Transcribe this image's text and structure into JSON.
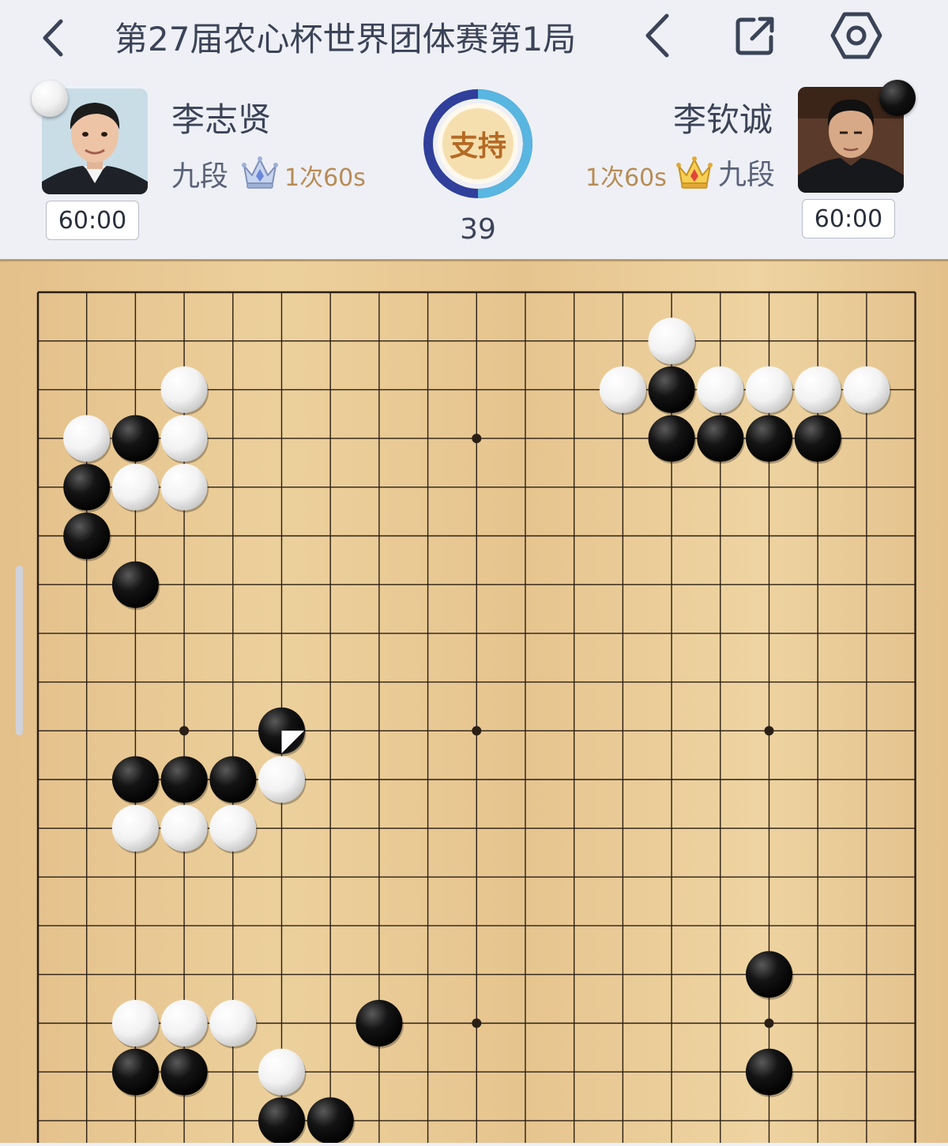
{
  "topbar": {
    "title": "第27届农心杯世界团体赛第1局",
    "back_icon": "chevron-left-icon",
    "prev_icon": "chevron-left-icon",
    "share_icon": "share-external-icon",
    "settings_icon": "gear-hexagon-icon"
  },
  "players": {
    "white": {
      "name": "李志贤",
      "rank": "九段",
      "byoyomi": "1次60s",
      "clock": "60:00",
      "stone": "white",
      "crown": "silver-crown-icon"
    },
    "black": {
      "name": "李钦诚",
      "rank": "九段",
      "byoyomi": "1次60s",
      "clock": "60:00",
      "stone": "black",
      "crown": "gold-crown-icon"
    }
  },
  "support": {
    "label": "支持",
    "white_share": 0.5,
    "black_share": 0.5
  },
  "move_number": "39",
  "colors": {
    "board": "#e8c890",
    "white_side": "#58b6e0",
    "black_side": "#2f3f9a",
    "accent_text": "#b88c55"
  },
  "board": {
    "size": 19,
    "visible_rows": 18,
    "star_points": [
      [
        3,
        3
      ],
      [
        9,
        3
      ],
      [
        15,
        3
      ],
      [
        3,
        9
      ],
      [
        9,
        9
      ],
      [
        15,
        9
      ],
      [
        3,
        15
      ],
      [
        9,
        15
      ],
      [
        15,
        15
      ]
    ],
    "black": [
      [
        13,
        2
      ],
      [
        13,
        3
      ],
      [
        14,
        3
      ],
      [
        15,
        3
      ],
      [
        16,
        3
      ],
      [
        2,
        3
      ],
      [
        1,
        4
      ],
      [
        1,
        5
      ],
      [
        2,
        6
      ],
      [
        5,
        9
      ],
      [
        2,
        10
      ],
      [
        3,
        10
      ],
      [
        4,
        10
      ],
      [
        7,
        15
      ],
      [
        15,
        14
      ],
      [
        2,
        16
      ],
      [
        3,
        16
      ],
      [
        15,
        16
      ],
      [
        5,
        17
      ],
      [
        6,
        17
      ]
    ],
    "white": [
      [
        13,
        1
      ],
      [
        12,
        2
      ],
      [
        14,
        2
      ],
      [
        15,
        2
      ],
      [
        16,
        2
      ],
      [
        17,
        2
      ],
      [
        3,
        2
      ],
      [
        1,
        3
      ],
      [
        3,
        3
      ],
      [
        2,
        4
      ],
      [
        3,
        4
      ],
      [
        5,
        10
      ],
      [
        2,
        11
      ],
      [
        3,
        11
      ],
      [
        4,
        11
      ],
      [
        2,
        15
      ],
      [
        3,
        15
      ],
      [
        4,
        15
      ],
      [
        5,
        16
      ]
    ],
    "last_move": [
      5,
      9
    ]
  }
}
